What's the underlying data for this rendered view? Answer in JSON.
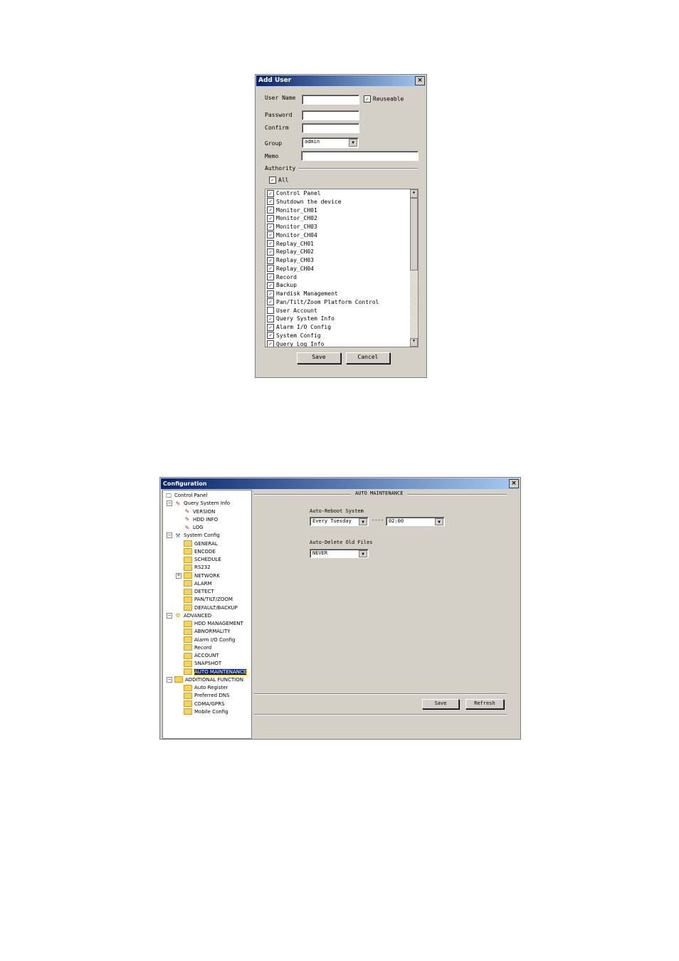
{
  "add_user": {
    "title": "Add User",
    "close": "×",
    "user_name_label": "User Name",
    "user_name_value": "",
    "reuseable_label": "Reuseable",
    "reuseable_checked": true,
    "password_label": "Password",
    "confirm_label": "Confirm",
    "group_label": "Group",
    "group_value": "admin",
    "memo_label": "Memo",
    "authority_label": "Authority",
    "all_label": "All",
    "all_checked": true,
    "authorities": [
      {
        "label": "Control Panel",
        "checked": true
      },
      {
        "label": "Shutdown the device",
        "checked": true
      },
      {
        "label": "Monitor_CH01",
        "checked": true
      },
      {
        "label": "Monitor_CH02",
        "checked": true
      },
      {
        "label": "Monitor_CH03",
        "checked": true
      },
      {
        "label": "Monitor_CH04",
        "checked": true
      },
      {
        "label": "Replay_CH01",
        "checked": true
      },
      {
        "label": "Replay_CH02",
        "checked": true
      },
      {
        "label": "Replay_CH03",
        "checked": true
      },
      {
        "label": "Replay_CH04",
        "checked": true
      },
      {
        "label": "Record",
        "checked": true
      },
      {
        "label": "Backup",
        "checked": true
      },
      {
        "label": "Hardisk Management",
        "checked": true
      },
      {
        "label": "Pan/Tilt/Zoom Platform Control",
        "checked": true
      },
      {
        "label": "User Account",
        "checked": false
      },
      {
        "label": "Query System Info",
        "checked": true
      },
      {
        "label": "Alarm I/O Config",
        "checked": true
      },
      {
        "label": "System Config",
        "checked": true
      },
      {
        "label": "Query Log Info",
        "checked": true
      }
    ],
    "save": "Save",
    "cancel": "Cancel"
  },
  "config": {
    "title": "Configuration",
    "close": "×",
    "tree": [
      {
        "label": "Control Panel",
        "level": 0,
        "icon": "monitor"
      },
      {
        "label": "Query System Info",
        "level": 1,
        "icon": "notepad",
        "expander": "−"
      },
      {
        "label": "VERSION",
        "level": 2,
        "icon": "notepad"
      },
      {
        "label": "HDD INFO",
        "level": 2,
        "icon": "notepad"
      },
      {
        "label": "LOG",
        "level": 2,
        "icon": "notepad"
      },
      {
        "label": "System Config",
        "level": 1,
        "icon": "tools",
        "expander": "−"
      },
      {
        "label": "GENERAL",
        "level": 2,
        "icon": "folder"
      },
      {
        "label": "ENCODE",
        "level": 2,
        "icon": "folder"
      },
      {
        "label": "SCHEDULE",
        "level": 2,
        "icon": "folder"
      },
      {
        "label": "RS232",
        "level": 2,
        "icon": "folder"
      },
      {
        "label": "NETWORK",
        "level": 2,
        "icon": "folder",
        "expander": "+"
      },
      {
        "label": "ALARM",
        "level": 2,
        "icon": "folder"
      },
      {
        "label": "DETECT",
        "level": 2,
        "icon": "folder"
      },
      {
        "label": "PAN/TILT/ZOOM",
        "level": 2,
        "icon": "folder"
      },
      {
        "label": "DEFAULT/BACKUP",
        "level": 2,
        "icon": "folder"
      },
      {
        "label": "ADVANCED",
        "level": 1,
        "icon": "gears",
        "expander": "−"
      },
      {
        "label": "HDD MANAGEMENT",
        "level": 2,
        "icon": "folder"
      },
      {
        "label": "ABNORMALITY",
        "level": 2,
        "icon": "folder"
      },
      {
        "label": "Alarm I/O Config",
        "level": 2,
        "icon": "folder"
      },
      {
        "label": "Record",
        "level": 2,
        "icon": "folder"
      },
      {
        "label": "ACCOUNT",
        "level": 2,
        "icon": "folder"
      },
      {
        "label": "SNAPSHOT",
        "level": 2,
        "icon": "folder"
      },
      {
        "label": "AUTO MAINTENANCE",
        "level": 2,
        "icon": "folder-open",
        "selected": true
      },
      {
        "label": "ADDITIONAL FUNCTION",
        "level": 1,
        "icon": "folder",
        "expander": "−"
      },
      {
        "label": "Auto Register",
        "level": 2,
        "icon": "folder"
      },
      {
        "label": "Preferred DNS",
        "level": 2,
        "icon": "folder"
      },
      {
        "label": "CDMA/GPRS",
        "level": 2,
        "icon": "folder"
      },
      {
        "label": "Mobile Config",
        "level": 2,
        "icon": "folder"
      }
    ],
    "section_title": "AUTO MAINTENANCE",
    "auto_reboot_label": "Auto-Reboot System",
    "reboot_day": "Every Tuesday",
    "separator": "----",
    "reboot_time": "02:00",
    "auto_delete_label": "Auto-Delete Old Files",
    "delete_value": "NEVER",
    "save": "Save",
    "refresh": "Refresh"
  }
}
